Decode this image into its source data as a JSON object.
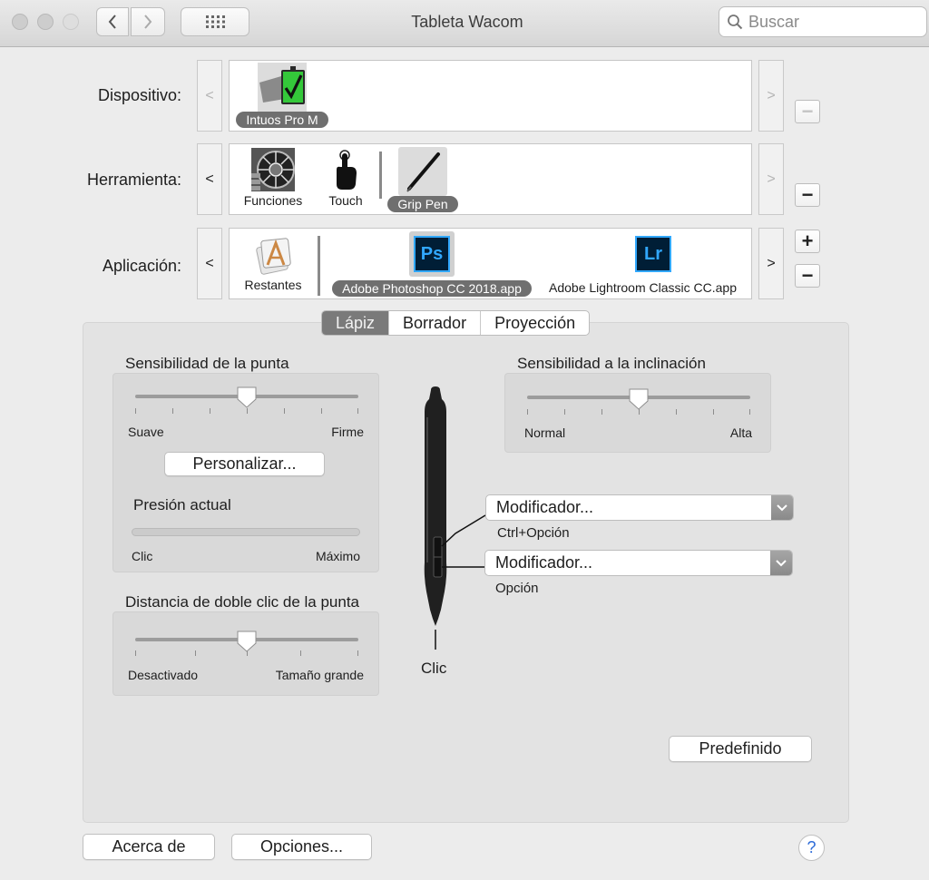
{
  "window": {
    "title": "Tableta Wacom"
  },
  "search": {
    "placeholder": "Buscar"
  },
  "rows": {
    "device": {
      "label": "Dispositivo:",
      "item": "Intuos Pro M"
    },
    "tool": {
      "label": "Herramienta:",
      "items": [
        "Funciones",
        "Touch",
        "Grip Pen"
      ]
    },
    "application": {
      "label": "Aplicación:",
      "items": [
        "Restantes",
        "Adobe Photoshop CC 2018.app",
        "Adobe Lightroom Classic CC.app"
      ],
      "ps_glyph": "Ps",
      "lr_glyph": "Lr"
    }
  },
  "tabs": [
    "Lápiz",
    "Borrador",
    "Proyección"
  ],
  "tip_sensitivity": {
    "title": "Sensibilidad de la punta",
    "min": "Suave",
    "max": "Firme",
    "level": 0.5
  },
  "customize_button": "Personalizar...",
  "current_pressure": {
    "title": "Presión actual",
    "min": "Clic",
    "max": "Máximo",
    "level": 0
  },
  "double_click": {
    "title": "Distancia de doble clic de la punta",
    "min": "Desactivado",
    "max": "Tamaño grande",
    "level": 0.5
  },
  "tilt_sensitivity": {
    "title": "Sensibilidad a la inclinación",
    "min": "Normal",
    "max": "Alta",
    "level": 0.5
  },
  "pen_buttons": {
    "upper": {
      "value": "Modificador...",
      "caption": "Ctrl+Opción"
    },
    "lower": {
      "value": "Modificador...",
      "caption": "Opción"
    },
    "tip_caption": "Clic"
  },
  "default_button": "Predefinido",
  "footer": {
    "about": "Acerca de",
    "options": "Opciones...",
    "help": "?"
  }
}
